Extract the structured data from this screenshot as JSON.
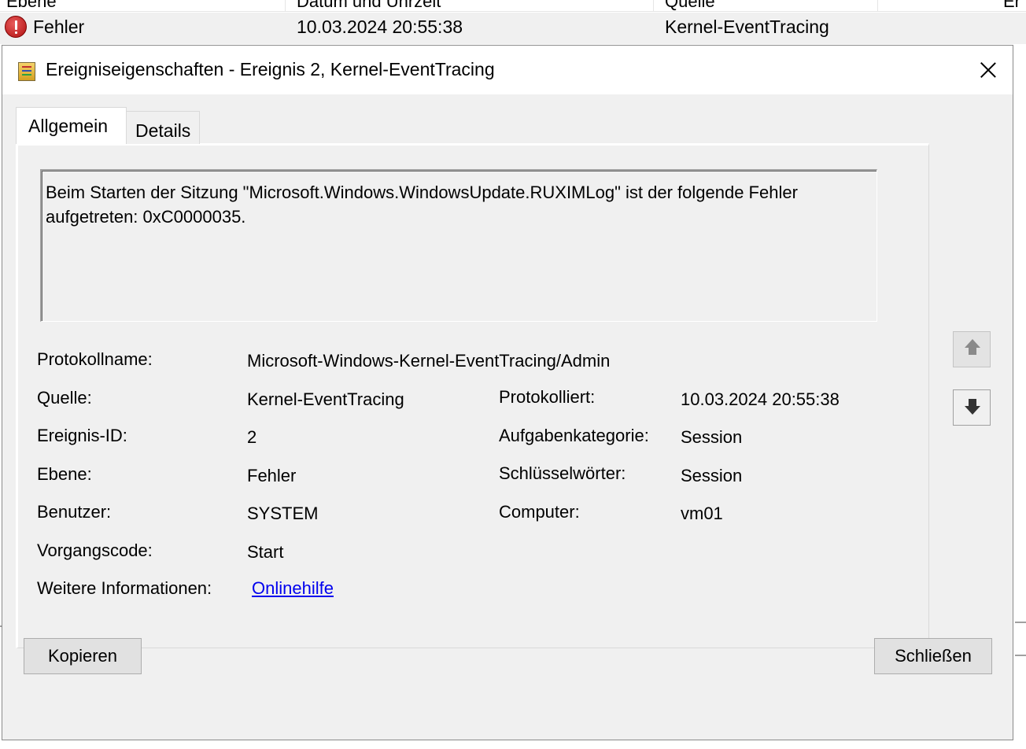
{
  "background_list": {
    "headers": [
      "Ebene",
      "Datum und Uhrzeit",
      "Quelle",
      "Er"
    ],
    "row": {
      "level": "Fehler",
      "datetime": "10.03.2024 20:55:38",
      "source": "Kernel-EventTracing"
    }
  },
  "dialog": {
    "title": "Ereigniseigenschaften - Ereignis 2, Kernel-EventTracing",
    "tabs": [
      "Allgemein",
      "Details"
    ],
    "active_tab": "Allgemein",
    "description": "Beim Starten der Sitzung \"Microsoft.Windows.WindowsUpdate.RUXIMLog\" ist der folgende Fehler aufgetreten: 0xC0000035.",
    "fields": {
      "log_name_label": "Protokollname:",
      "log_name": "Microsoft-Windows-Kernel-EventTracing/Admin",
      "source_label": "Quelle:",
      "source": "Kernel-EventTracing",
      "logged_label": "Protokolliert:",
      "logged": "10.03.2024 20:55:38",
      "event_id_label": "Ereignis-ID:",
      "event_id": "2",
      "task_category_label": "Aufgabenkategorie:",
      "task_category": "Session",
      "level_label": "Ebene:",
      "level": "Fehler",
      "keywords_label": "Schlüsselwörter:",
      "keywords": "Session",
      "user_label": "Benutzer:",
      "user": "SYSTEM",
      "computer_label": "Computer:",
      "computer": "vm01",
      "opcode_label": "Vorgangscode:",
      "opcode": "Start",
      "more_info_label": "Weitere Informationen:",
      "more_info_link": "Onlinehilfe"
    },
    "buttons": {
      "copy": "Kopieren",
      "close": "Schließen"
    },
    "icons": {
      "title_icon": "event-viewer-icon",
      "close_icon": "close-icon",
      "up_icon": "arrow-up-icon",
      "down_icon": "arrow-down-icon",
      "error_icon": "error-icon"
    }
  }
}
